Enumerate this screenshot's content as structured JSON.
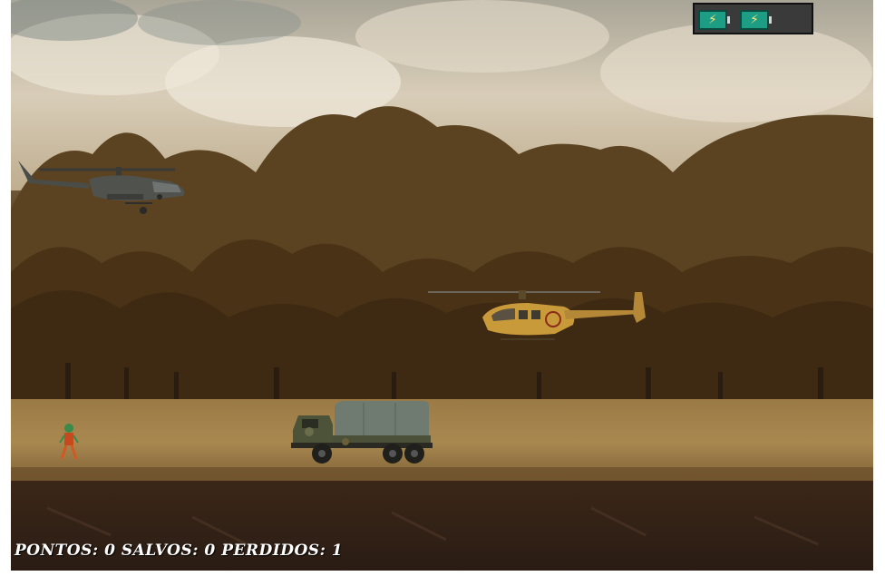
{
  "hud": {
    "batteries": [
      {
        "icon": "battery-charged-icon"
      },
      {
        "icon": "battery-charged-icon"
      }
    ]
  },
  "score": {
    "pontos_label": "PONTOS:",
    "pontos_value": "0",
    "salvos_label": "SALVOS:",
    "salvos_value": "0",
    "perdidos_label": "PERDIDOS:",
    "perdidos_value": "1"
  },
  "sprites": {
    "player_helicopter": "attack-helicopter-icon",
    "rescue_helicopter": "rescue-helicopter-icon",
    "truck": "military-truck-icon",
    "soldier": "soldier-icon"
  },
  "colors": {
    "score_text": "#ffffff",
    "battery": "#1d9d84",
    "rescue_helicopter": "#c89a3a",
    "attack_helicopter": "#4a4c48",
    "truck_cover": "#6f7a70"
  }
}
